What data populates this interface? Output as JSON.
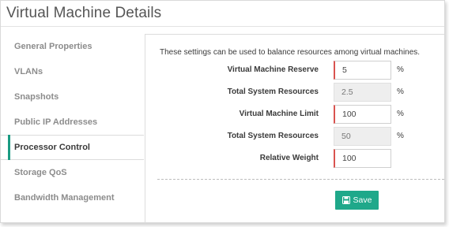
{
  "header": {
    "title": "Virtual Machine Details"
  },
  "sidebar": {
    "items": [
      {
        "label": "General Properties",
        "active": false
      },
      {
        "label": "VLANs",
        "active": false
      },
      {
        "label": "Snapshots",
        "active": false
      },
      {
        "label": "Public IP Addresses",
        "active": false
      },
      {
        "label": "Processor Control",
        "active": true
      },
      {
        "label": "Storage QoS",
        "active": false
      },
      {
        "label": "Bandwidth Management",
        "active": false
      }
    ]
  },
  "main": {
    "intro": "These settings can be used to balance resources among virtual machines.",
    "fields": [
      {
        "label": "Virtual Machine Reserve",
        "value": "5",
        "unit": "%",
        "editable": true
      },
      {
        "label": "Total System Resources",
        "value": "2.5",
        "unit": "%",
        "editable": false
      },
      {
        "label": "Virtual Machine Limit",
        "value": "100",
        "unit": "%",
        "editable": true
      },
      {
        "label": "Total System Resources",
        "value": "50",
        "unit": "%",
        "editable": false
      },
      {
        "label": "Relative Weight",
        "value": "100",
        "unit": "",
        "editable": true
      }
    ],
    "save_label": "Save"
  },
  "colors": {
    "accent": "#1fa88a",
    "active_indicator": "#1a9b82",
    "required_marker": "#d9534f"
  },
  "icons": {
    "save": "floppy-disk-icon"
  }
}
